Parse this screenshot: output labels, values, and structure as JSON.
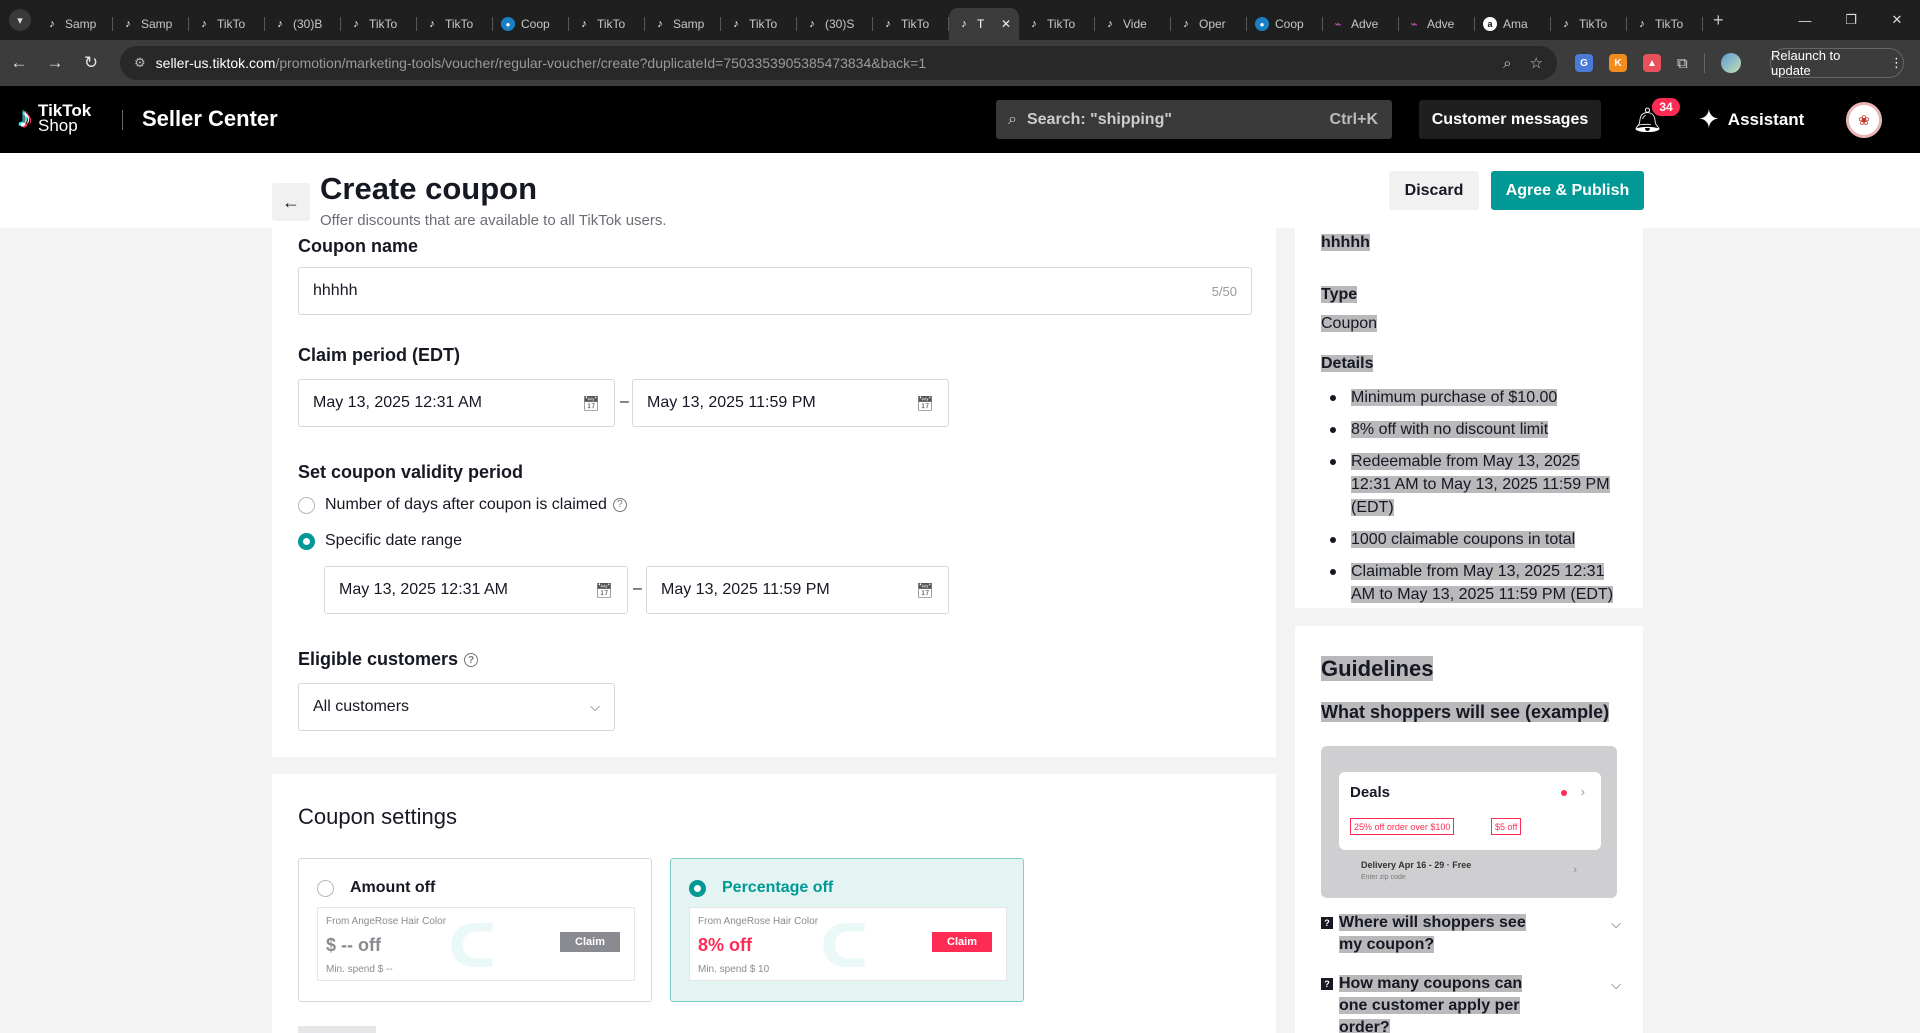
{
  "browser": {
    "tabs": [
      {
        "title": "Samp",
        "icon": "tiktok-icon"
      },
      {
        "title": "Samp",
        "icon": "tiktok-icon"
      },
      {
        "title": "TikTo",
        "icon": "tiktok-icon"
      },
      {
        "title": "(30)B",
        "icon": "tiktok-icon"
      },
      {
        "title": "TikTo",
        "icon": "tiktok-icon"
      },
      {
        "title": "TikTo",
        "icon": "tiktok-icon"
      },
      {
        "title": "Coop",
        "icon": "chat-icon"
      },
      {
        "title": "TikTo",
        "icon": "tiktok-icon"
      },
      {
        "title": "Samp",
        "icon": "tiktok-icon"
      },
      {
        "title": "TikTo",
        "icon": "tiktok-icon"
      },
      {
        "title": "(30)S",
        "icon": "tiktok-icon"
      },
      {
        "title": "TikTo",
        "icon": "tiktok-icon"
      },
      {
        "title": "T",
        "icon": "tiktok-icon",
        "active": true
      },
      {
        "title": "TikTo",
        "icon": "tiktok-icon"
      },
      {
        "title": "Vide",
        "icon": "tiktok-icon"
      },
      {
        "title": "Oper",
        "icon": "tiktok-icon"
      },
      {
        "title": "Coop",
        "icon": "chat-icon"
      },
      {
        "title": "Adve",
        "icon": "ads-icon"
      },
      {
        "title": "Adve",
        "icon": "ads-icon"
      },
      {
        "title": "Ama",
        "icon": "amazon-icon"
      },
      {
        "title": "TikTo",
        "icon": "tiktok-icon"
      },
      {
        "title": "TikTo",
        "icon": "tiktok-icon"
      }
    ],
    "url_host": "seller-us.tiktok.com",
    "url_path": "/promotion/marketing-tools/voucher/regular-voucher/create?duplicateId=7503353905385473834&back=1",
    "relaunch_label": "Relaunch to update"
  },
  "header": {
    "logo_line1": "TikTok",
    "logo_line2": "Shop",
    "app_name": "Seller Center",
    "search_placeholder": "Search: \"shipping\"",
    "search_shortcut": "Ctrl+K",
    "customer_messages": "Customer messages",
    "notification_count": "34",
    "assistant_label": "Assistant"
  },
  "page": {
    "title": "Create coupon",
    "subtitle": "Offer discounts that are available to all TikTok users.",
    "discard_label": "Discard",
    "publish_label": "Agree & Publish"
  },
  "form": {
    "coupon_name_label": "Coupon name",
    "coupon_name_value": "hhhhh",
    "coupon_name_count": "5/50",
    "claim_period_label": "Claim period (EDT)",
    "claim_start": "May 13, 2025 12:31 AM",
    "claim_end": "May 13, 2025 11:59 PM",
    "validity_label": "Set coupon validity period",
    "validity_option_days": "Number of days after coupon is claimed",
    "validity_option_range": "Specific date range",
    "validity_start": "May 13, 2025 12:31 AM",
    "validity_end": "May 13, 2025 11:59 PM",
    "eligible_label": "Eligible customers",
    "eligible_value": "All customers",
    "range_separator": "–"
  },
  "settings": {
    "title": "Coupon settings",
    "amount": {
      "label": "Amount off",
      "from": "From AngeRose Hair Color",
      "value": "$ -- off",
      "min_spend": "Min. spend $ --",
      "claim": "Claim"
    },
    "percentage": {
      "label": "Percentage off",
      "from": "From AngeRose Hair Color",
      "value": "8% off",
      "min_spend": "Min. spend $ 10",
      "claim": "Claim"
    }
  },
  "summary": {
    "name": "hhhhh",
    "type_label": "Type",
    "type_value": "Coupon",
    "details_label": "Details",
    "details": [
      "Minimum purchase of $10.00",
      "8% off with no discount limit",
      "Redeemable from May 13, 2025 12:31 AM to May 13, 2025 11:59 PM (EDT)",
      "1000 claimable coupons in total",
      "Claimable from May 13, 2025 12:31 AM to May 13, 2025 11:59 PM (EDT)"
    ]
  },
  "guidelines": {
    "title": "Guidelines",
    "example_label": "What shoppers will see (example)",
    "preview": {
      "deals": "Deals",
      "tag1": "25% off order over $100",
      "tag2": "$5 off",
      "delivery": "Delivery Apr 16 - 29 · Free",
      "zip": "Enter zip code"
    },
    "faq": [
      "Where will shoppers see my coupon?",
      "How many coupons can one customer apply per order?"
    ]
  },
  "colors": {
    "accent": "#009995",
    "brand_red": "#fe2c55",
    "header_bg": "#000000"
  }
}
